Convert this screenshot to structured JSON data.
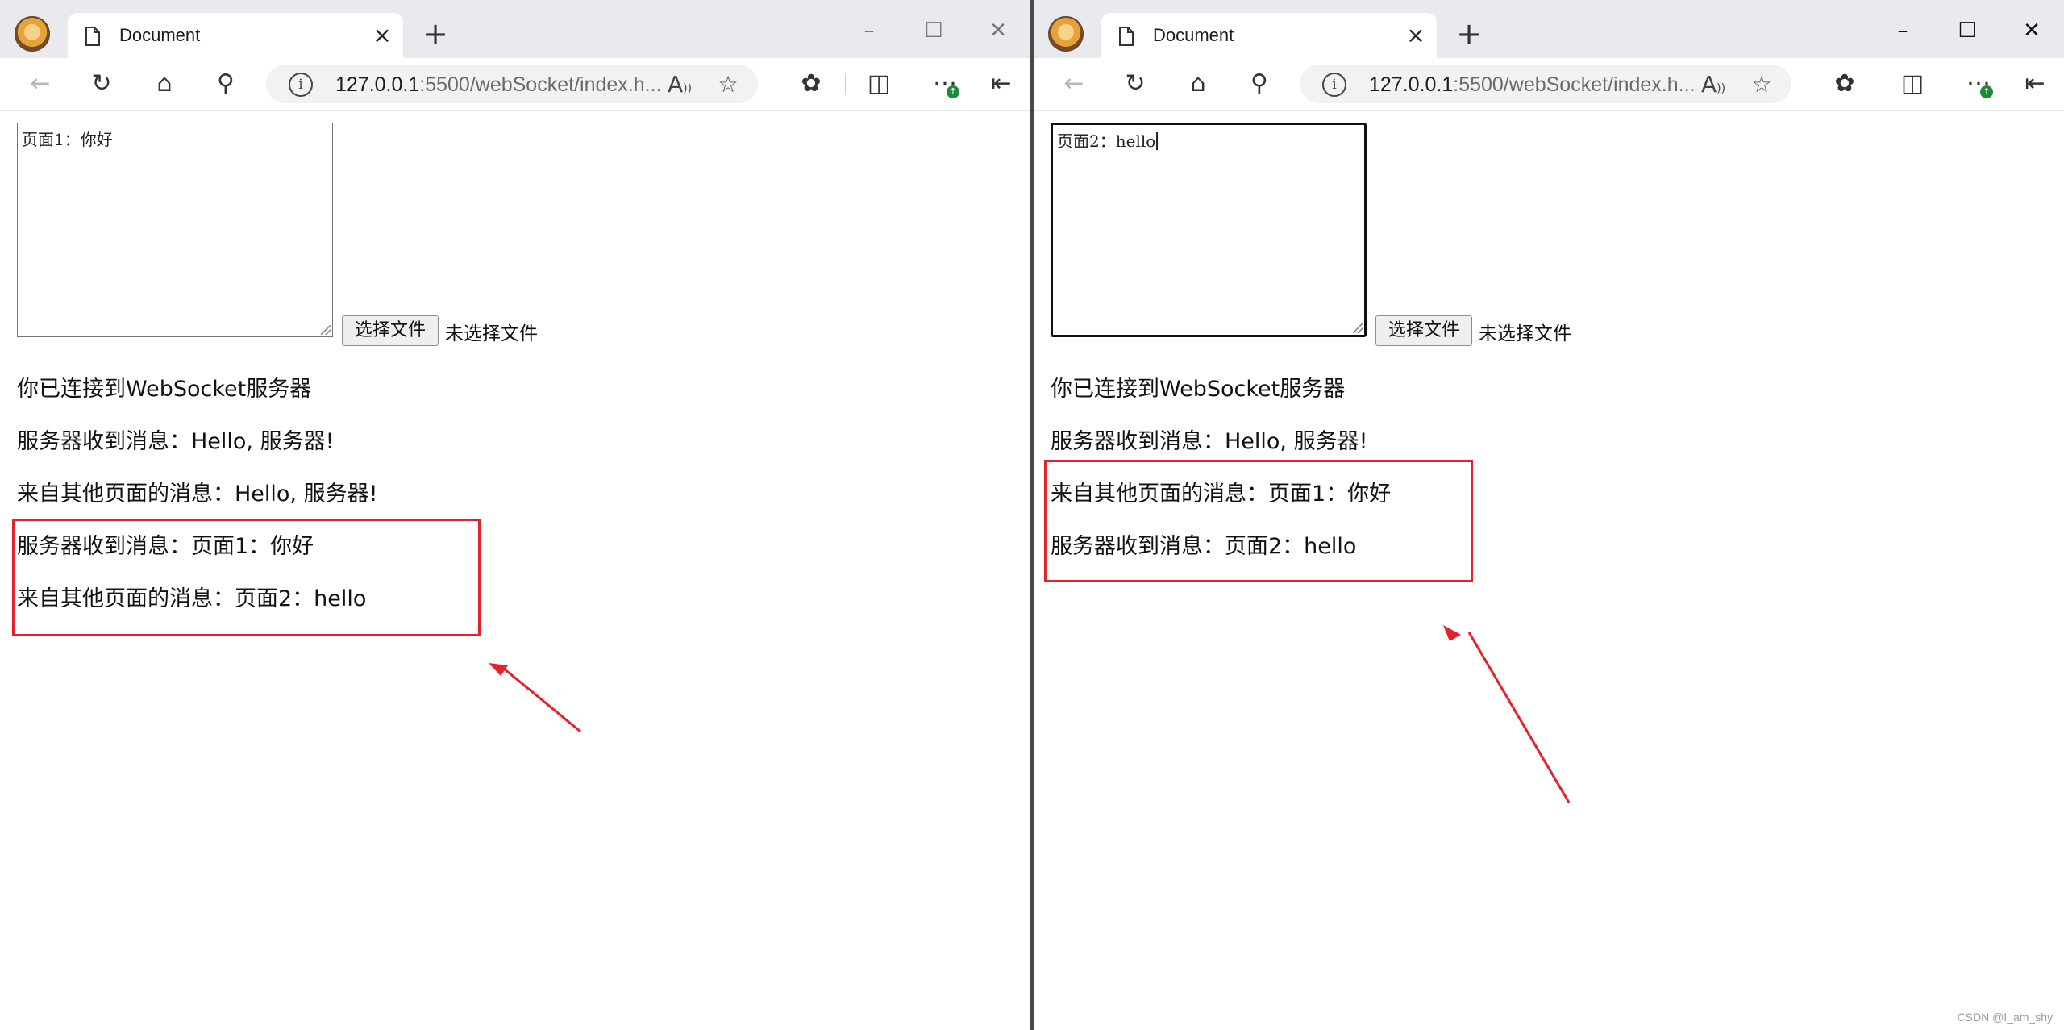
{
  "windows": {
    "left": {
      "tab_title": "Document",
      "url_host": "127.0.0.1",
      "url_rest": ":5500/webSocket/index.h...",
      "textarea_value": "页面1：你好",
      "file_button_label": "选择文件",
      "file_status": "未选择文件",
      "messages": [
        "你已连接到WebSocket服务器",
        "服务器收到消息：Hello, 服务器!",
        "来自其他页面的消息：Hello, 服务器!",
        "服务器收到消息：页面1：你好",
        "来自其他页面的消息：页面2：hello"
      ]
    },
    "right": {
      "tab_title": "Document",
      "url_host": "127.0.0.1",
      "url_rest": ":5500/webSocket/index.h...",
      "textarea_value": "页面2：hello",
      "file_button_label": "选择文件",
      "file_status": "未选择文件",
      "messages": [
        "你已连接到WebSocket服务器",
        "服务器收到消息：Hello, 服务器!",
        "来自其他页面的消息：页面1：你好",
        "服务器收到消息：页面2：hello"
      ]
    }
  },
  "icons": {
    "window_controls": [
      "minimize-icon",
      "maximize-icon",
      "close-icon"
    ],
    "toolbar": [
      "back-icon",
      "refresh-icon",
      "home-icon",
      "search-icon",
      "read-aloud-icon",
      "favorite-star-icon",
      "extensions-icon",
      "split-screen-icon",
      "more-icon",
      "sidebar-icon"
    ]
  },
  "colors": {
    "highlight": "#e5212b",
    "update_badge": "#1f8a3c"
  },
  "watermark": "CSDN @I_am_shy"
}
